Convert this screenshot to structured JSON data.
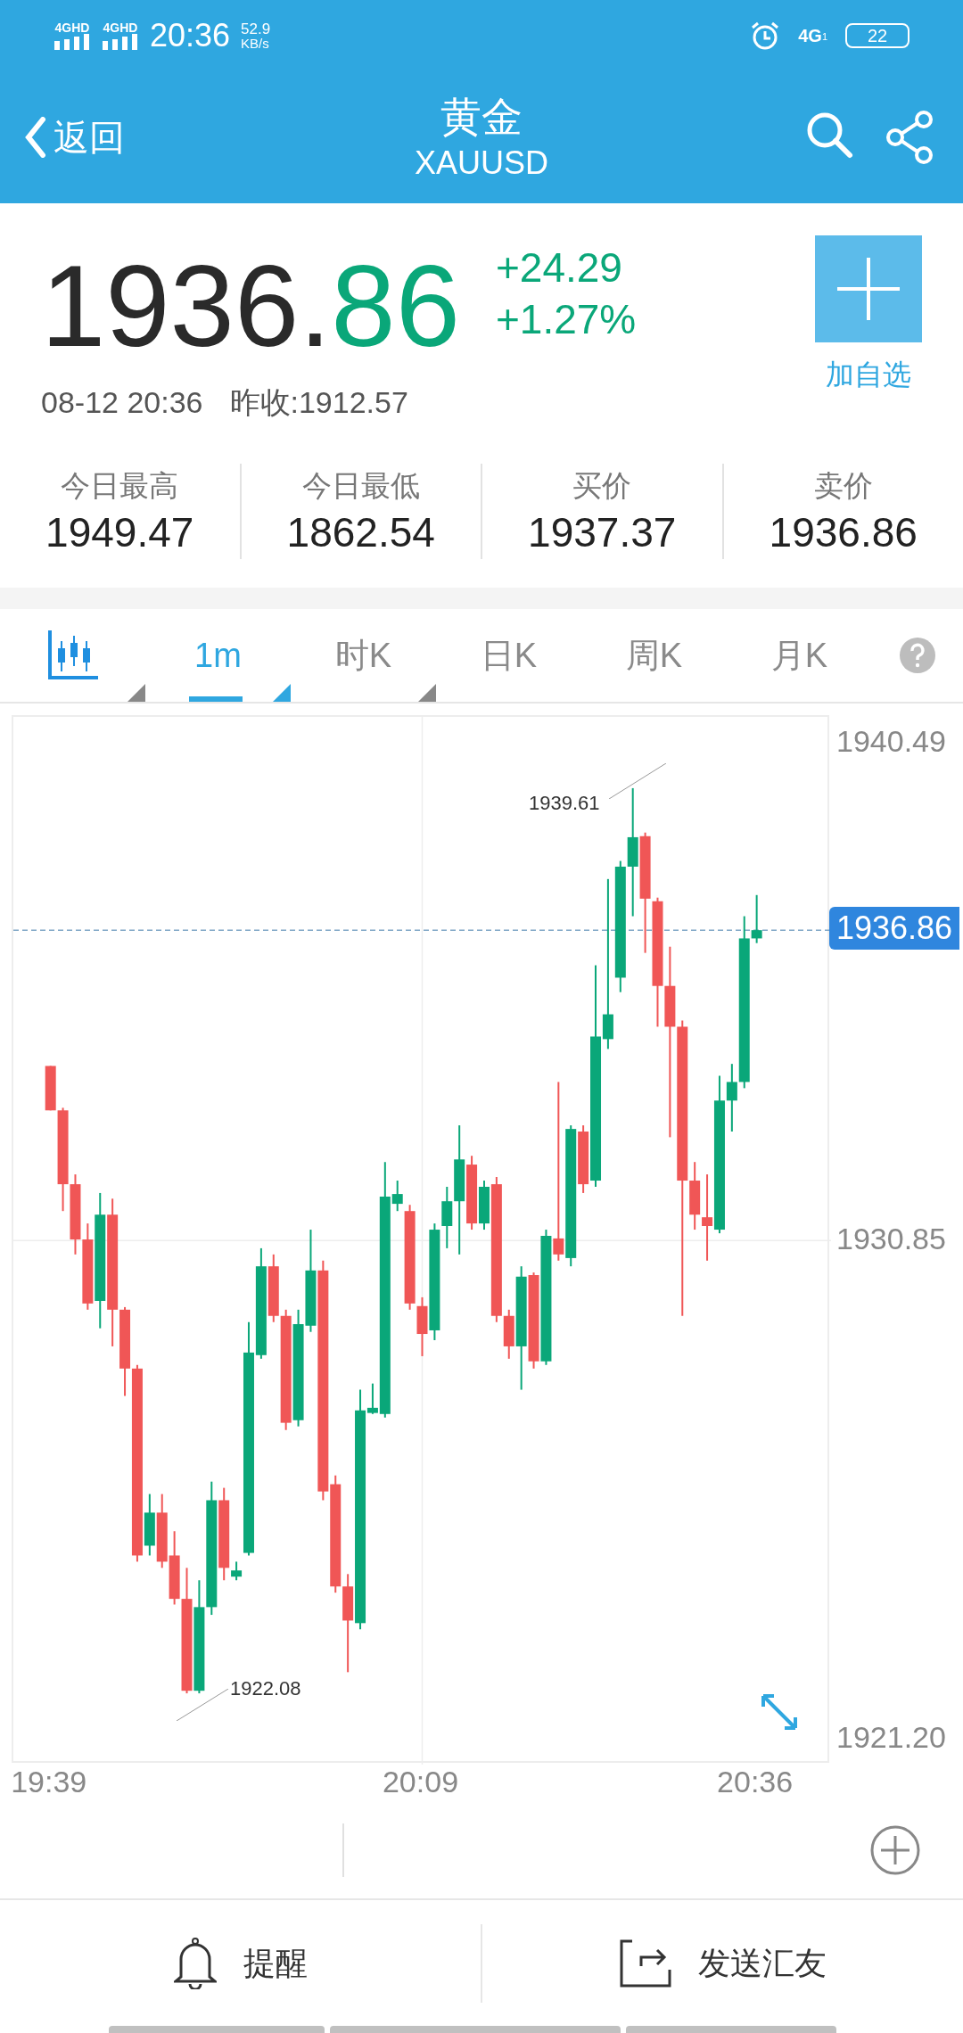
{
  "status_bar": {
    "sim1": "4GHD",
    "sim2": "4GHD",
    "time": "20:36",
    "net_speed": "52.9",
    "net_unit": "KB/s",
    "network": "4G",
    "network_sub": "1",
    "battery": "22"
  },
  "header": {
    "back": "返回",
    "title": "黄金",
    "subtitle": "XAUUSD"
  },
  "quote": {
    "price_int": "1936.",
    "price_dec": "86",
    "change": "+24.29",
    "change_pct": "+1.27%",
    "datetime": "08-12 20:36",
    "prev_close": "昨收:1912.57",
    "add_label": "加自选"
  },
  "stats": [
    {
      "label": "今日最高",
      "value": "1949.47"
    },
    {
      "label": "今日最低",
      "value": "1862.54"
    },
    {
      "label": "买价",
      "value": "1937.37"
    },
    {
      "label": "卖价",
      "value": "1936.86"
    }
  ],
  "tabs": [
    {
      "kind": "icon",
      "selected": false,
      "dropdown": true
    },
    {
      "kind": "text",
      "label": "1m",
      "selected": true,
      "dropdown": true
    },
    {
      "kind": "text",
      "label": "时K",
      "selected": false,
      "dropdown": true
    },
    {
      "kind": "text",
      "label": "日K",
      "selected": false,
      "dropdown": false
    },
    {
      "kind": "text",
      "label": "周K",
      "selected": false,
      "dropdown": false
    },
    {
      "kind": "text",
      "label": "月K",
      "selected": false,
      "dropdown": false
    }
  ],
  "chart": {
    "high_label": "1939.61",
    "low_label": "1922.08",
    "chart_data": {
      "type": "candlestick",
      "x": [
        1179,
        1180,
        1181,
        1182,
        1183,
        1184,
        1185,
        1186,
        1187,
        1188,
        1189,
        1190,
        1191,
        1192,
        1193,
        1194,
        1195,
        1196,
        1197,
        1198,
        1199,
        1200,
        1201,
        1202,
        1203,
        1204,
        1205,
        1206,
        1207,
        1208,
        1209,
        1210,
        1211,
        1212,
        1213,
        1214,
        1215,
        1216,
        1217,
        1218,
        1219,
        1220,
        1221,
        1222,
        1223,
        1224,
        1225,
        1226,
        1227,
        1228,
        1229,
        1230,
        1231,
        1232,
        1233,
        1234,
        1235,
        1236
      ],
      "xlim": [
        1176,
        1242
      ],
      "ohlc": [
        [
          1934.23,
          1934.23,
          1933.37,
          1933.37
        ],
        [
          1933.37,
          1933.42,
          1931.42,
          1931.94
        ],
        [
          1931.94,
          1932.13,
          1930.58,
          1930.87
        ],
        [
          1930.87,
          1931.18,
          1929.51,
          1929.63
        ],
        [
          1929.68,
          1931.77,
          1929.15,
          1931.35
        ],
        [
          1931.35,
          1931.66,
          1928.8,
          1929.51
        ],
        [
          1929.51,
          1929.56,
          1927.84,
          1928.37
        ],
        [
          1928.37,
          1928.44,
          1924.63,
          1924.75
        ],
        [
          1924.94,
          1925.94,
          1924.75,
          1925.58
        ],
        [
          1925.58,
          1925.94,
          1924.51,
          1924.63
        ],
        [
          1924.75,
          1925.22,
          1923.8,
          1923.91
        ],
        [
          1923.91,
          1924.51,
          1922.08,
          1922.13
        ],
        [
          1922.13,
          1924.27,
          1922.08,
          1923.75
        ],
        [
          1923.75,
          1926.18,
          1923.6,
          1925.82
        ],
        [
          1925.82,
          1926.06,
          1924.27,
          1924.51
        ],
        [
          1924.34,
          1924.63,
          1924.27,
          1924.46
        ],
        [
          1924.8,
          1929.27,
          1924.75,
          1928.68
        ],
        [
          1928.63,
          1930.7,
          1928.56,
          1930.35
        ],
        [
          1930.35,
          1930.58,
          1929.27,
          1929.39
        ],
        [
          1929.39,
          1929.51,
          1927.18,
          1927.32
        ],
        [
          1927.37,
          1929.51,
          1927.25,
          1929.23
        ],
        [
          1929.2,
          1931.06,
          1929.08,
          1930.27
        ],
        [
          1930.27,
          1930.46,
          1925.82,
          1925.99
        ],
        [
          1926.13,
          1926.3,
          1924.03,
          1924.15
        ],
        [
          1924.15,
          1924.39,
          1922.49,
          1923.49
        ],
        [
          1923.44,
          1927.96,
          1923.32,
          1927.56
        ],
        [
          1927.51,
          1928.08,
          1927.49,
          1927.61
        ],
        [
          1927.49,
          1932.37,
          1927.42,
          1931.7
        ],
        [
          1931.56,
          1932.01,
          1931.42,
          1931.75
        ],
        [
          1931.42,
          1931.54,
          1929.51,
          1929.63
        ],
        [
          1929.58,
          1929.75,
          1928.61,
          1929.04
        ],
        [
          1929.11,
          1931.18,
          1928.92,
          1931.06
        ],
        [
          1931.13,
          1931.89,
          1930.7,
          1931.61
        ],
        [
          1931.61,
          1933.08,
          1930.58,
          1932.42
        ],
        [
          1932.32,
          1932.49,
          1931.06,
          1931.18
        ],
        [
          1931.18,
          1932.01,
          1931.06,
          1931.89
        ],
        [
          1931.94,
          1932.08,
          1929.27,
          1929.39
        ],
        [
          1929.39,
          1929.51,
          1928.56,
          1928.8
        ],
        [
          1928.8,
          1930.35,
          1927.96,
          1930.15
        ],
        [
          1930.18,
          1930.23,
          1928.37,
          1928.51
        ],
        [
          1928.51,
          1931.06,
          1928.44,
          1930.94
        ],
        [
          1930.89,
          1933.92,
          1930.46,
          1930.58
        ],
        [
          1930.51,
          1933.08,
          1930.35,
          1933.01
        ],
        [
          1932.96,
          1933.08,
          1931.77,
          1931.94
        ],
        [
          1932.01,
          1936.18,
          1931.89,
          1934.8
        ],
        [
          1934.75,
          1937.85,
          1934.56,
          1935.23
        ],
        [
          1935.94,
          1938.2,
          1935.66,
          1938.09
        ],
        [
          1938.09,
          1939.61,
          1937.13,
          1938.66
        ],
        [
          1938.68,
          1938.75,
          1936.42,
          1937.47
        ],
        [
          1937.42,
          1937.49,
          1934.99,
          1935.78
        ],
        [
          1935.78,
          1936.54,
          1932.85,
          1934.99
        ],
        [
          1934.99,
          1935.11,
          1929.39,
          1932.01
        ],
        [
          1932.01,
          1932.37,
          1931.06,
          1931.35
        ],
        [
          1931.3,
          1932.13,
          1930.46,
          1931.13
        ],
        [
          1931.06,
          1934.04,
          1930.99,
          1933.56
        ],
        [
          1933.56,
          1934.27,
          1932.96,
          1933.92
        ],
        [
          1933.92,
          1937.13,
          1933.8,
          1936.7
        ],
        [
          1936.7,
          1937.54,
          1936.61,
          1936.86
        ]
      ],
      "ylim": [
        1920.7,
        1940.99
      ],
      "ref_lines": [
        {
          "axis": "y",
          "value": 1936.86,
          "label": "1936.86"
        }
      ],
      "yticks": [
        {
          "value": 1940.49,
          "label": "1940.49"
        },
        {
          "value": 1930.85,
          "label": "1930.85"
        },
        {
          "value": 1921.2,
          "label": "1921.20"
        }
      ],
      "xticks": [
        {
          "value": 1179,
          "label": "19:39"
        },
        {
          "value": 1209,
          "label": "20:09"
        },
        {
          "value": 1236,
          "label": "20:36"
        }
      ]
    }
  },
  "actions": [
    {
      "kind": "bell",
      "label": "提醒"
    },
    {
      "kind": "share",
      "label": "发送汇友"
    }
  ]
}
